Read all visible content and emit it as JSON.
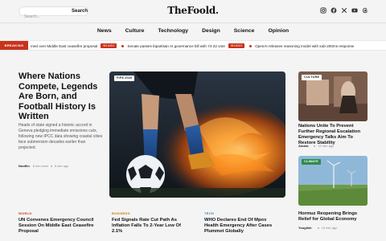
{
  "header": {
    "search_placeholder": "Search...",
    "search_button": "Search",
    "logo": "TheFoold.",
    "social": [
      "instagram-icon",
      "facebook-icon",
      "x-icon",
      "youtube-icon",
      "threads-icon"
    ]
  },
  "nav": {
    "items": [
      "News",
      "Culture",
      "Technology",
      "Design",
      "Science",
      "Opinion"
    ]
  },
  "ticker": {
    "label": "BREAKING",
    "items": [
      {
        "text": "med over Middle East ceasefire proposal",
        "time": "9H AGO"
      },
      {
        "text": "Senate passes bipartisan AI governance bill with 74-22 vote",
        "time": "9H AGO"
      },
      {
        "text": "OpenAI releases reasoning model with sub-200ms response",
        "time": "9H AGO"
      }
    ]
  },
  "hero": {
    "title": "Where Nations Compete, Legends Are Born, and Football History Is Written",
    "summary": "Heads of state signed a historic accord in Geneva pledging immediate emissions cuts, following new IPCC data showing coastal cities face submersion decades earlier than projected.",
    "author": "Nooflin",
    "read_time": "8 min read",
    "ago": "5 min ago",
    "badge": "FIFA 2026"
  },
  "side_cards": [
    {
      "category": "CULTURE",
      "title": "Nations Unite To Prevent Further Regional Escalation Emergency Talks Aim To Restore Stability",
      "author": "Amara",
      "ago": "10 min ago"
    },
    {
      "category": "CLIMATE",
      "title": "Hormuz Reopening Brings Relief for Global Economy",
      "author": "Youglish",
      "ago": "15 min ago"
    }
  ],
  "bottom_cards": [
    {
      "category": "WORLD",
      "title": "UN Convenes Emergency Council Session On Middle East Ceasefire Proposal",
      "color": "#c9331c"
    },
    {
      "category": "BUSINESS",
      "title": "Fed Signals Rate Cut Path As Inflation Falls To 2-Year Low Of 2.1%",
      "color": "#c77a12"
    },
    {
      "category": "TECH",
      "title": "WHO Declares End Of Mpox Health Emergency After Cases Plummet Globally",
      "color": "#2b7fb8"
    }
  ],
  "colors": {
    "accent": "#c9331c",
    "climate": "#2e8b4a"
  }
}
